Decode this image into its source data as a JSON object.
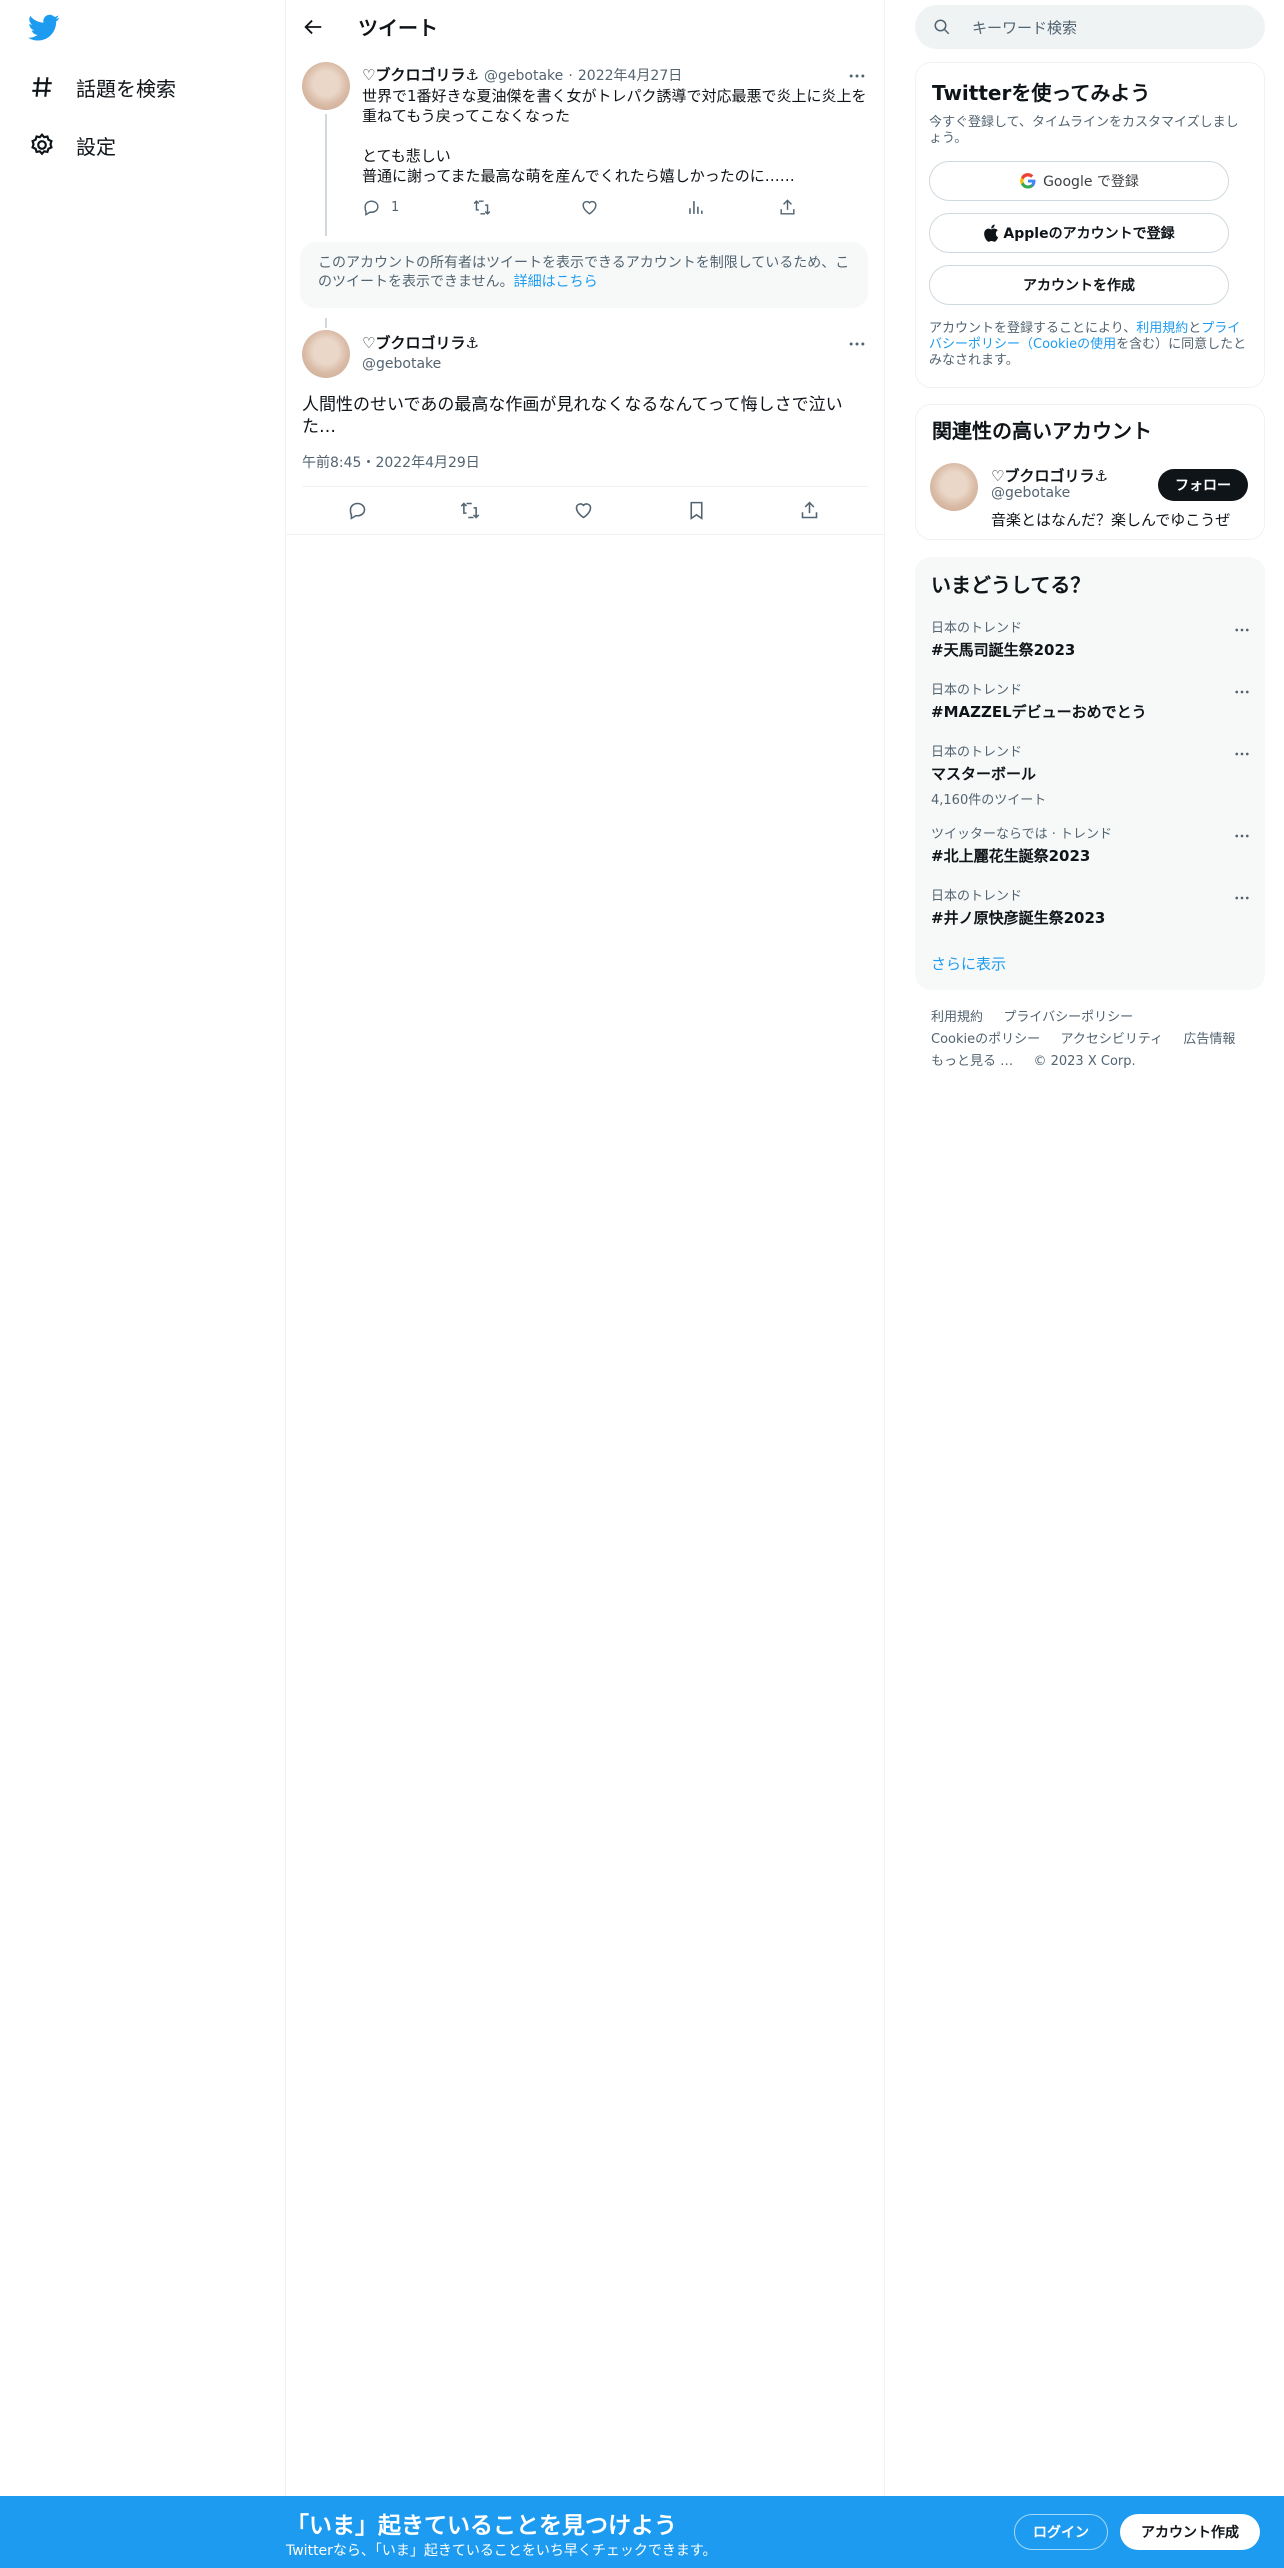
{
  "nav": {
    "items": [
      {
        "label": "話題を検索",
        "icon": "hashtag-icon"
      },
      {
        "label": "設定",
        "icon": "gear-icon"
      }
    ]
  },
  "header": {
    "title": "ツイート"
  },
  "tweet1": {
    "name": "♡ブクロゴリラ⚓",
    "handle": "@gebotake",
    "date": "2022年4月27日",
    "text": "世界で1番好きな夏油傑を書く女がトレパク誘導で対応最悪で炎上に炎上を重ねてもう戻ってこなくなった\n\nとても悲しい\n普通に謝ってまた最高な萌を産んでくれたら嬉しかったのに……",
    "reply_count": "1"
  },
  "notice": {
    "text": "このアカウントの所有者はツイートを表示できるアカウントを制限しているため、このツイートを表示できません。",
    "link": "詳細はこちら"
  },
  "tweet2": {
    "name": "♡ブクロゴリラ⚓",
    "handle": "@gebotake",
    "text": "人間性のせいであの最高な作画が見れなくなるなんてって悔しさで泣いた…",
    "timestamp": "午前8:45・2022年4月29日"
  },
  "search": {
    "placeholder": "キーワード検索"
  },
  "signup": {
    "title": "Twitterを使ってみよう",
    "subtitle": "今すぐ登録して、タイムラインをカスタマイズしましょう。",
    "google_label": "Google で登録",
    "apple_label": "Appleのアカウントで登録",
    "create_label": "アカウントを作成",
    "legal_prefix": "アカウントを登録することにより、",
    "legal_terms": "利用規約",
    "legal_and": "と",
    "legal_privacy": "プライバシーポリシー（Cookieの使用",
    "legal_suffix": "を含む）に同意したとみなされます。"
  },
  "related": {
    "title": "関連性の高いアカウント",
    "name": "♡ブクロゴリラ⚓",
    "handle": "@gebotake",
    "bio": "音楽とはなんだ？楽しんでゆこうぜ",
    "follow_label": "フォロー"
  },
  "trends": {
    "title": "いまどうしてる？",
    "items": [
      {
        "category": "日本のトレンド",
        "topic": "#天馬司誕生祭2023",
        "count": ""
      },
      {
        "category": "日本のトレンド",
        "topic": "#MAZZELデビューおめでとう",
        "count": ""
      },
      {
        "category": "日本のトレンド",
        "topic": "マスターボール",
        "count": "4,160件のツイート"
      },
      {
        "category": "ツイッターならでは · トレンド",
        "topic": "#北上麗花生誕祭2023",
        "count": ""
      },
      {
        "category": "日本のトレンド",
        "topic": "#井ノ原快彦誕生祭2023",
        "count": ""
      }
    ],
    "show_more": "さらに表示"
  },
  "footer": {
    "terms": "利用規約",
    "privacy": "プライバシーポリシー",
    "cookie": "Cookieのポリシー",
    "accessibility": "アクセシビリティ",
    "ads": "広告情報",
    "more": "もっと見る …",
    "copyright": "© 2023 X Corp."
  },
  "bottom_bar": {
    "headline": "「いま」起きていることを見つけよう",
    "sub": "Twitterなら、「いま」起きていることをいち早くチェックできます。",
    "login_label": "ログイン",
    "signup_label": "アカウント作成"
  },
  "colors": {
    "accent": "#1d9bf0",
    "text": "#0f1419",
    "muted": "#536471"
  }
}
